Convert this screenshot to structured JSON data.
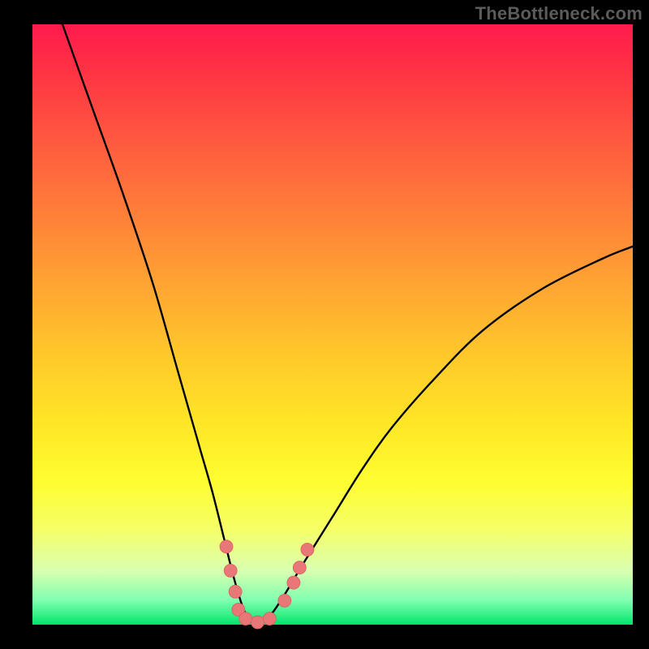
{
  "watermark": "TheBottleneck.com",
  "colors": {
    "page_bg": "#000000",
    "curve": "#000000",
    "dot_fill": "#e97777",
    "dot_stroke": "#d85f5f",
    "gradient_top": "#ff1a4d",
    "gradient_bottom": "#00e56a"
  },
  "chart_data": {
    "type": "line",
    "title": "",
    "xlabel": "",
    "ylabel": "",
    "xlim": [
      0,
      100
    ],
    "ylim": [
      0,
      100
    ],
    "grid": false,
    "legend": false,
    "series": [
      {
        "name": "bottleneck-curve",
        "x": [
          5,
          10,
          15,
          20,
          24,
          26,
          28,
          30,
          32,
          33.5,
          35,
          36,
          37,
          38,
          39,
          40,
          42,
          45,
          50,
          55,
          60,
          67,
          75,
          85,
          95,
          100
        ],
        "y": [
          100,
          86,
          72,
          57,
          43,
          36,
          29,
          22,
          14,
          8,
          3,
          1,
          0,
          0,
          1,
          2,
          5,
          10,
          18,
          26,
          33,
          41,
          49,
          56,
          61,
          63
        ]
      }
    ],
    "points": [
      {
        "name": "p1",
        "x": 32.3,
        "y": 13
      },
      {
        "name": "p2",
        "x": 33.0,
        "y": 9
      },
      {
        "name": "p3",
        "x": 33.8,
        "y": 5.5
      },
      {
        "name": "p4",
        "x": 34.3,
        "y": 2.5
      },
      {
        "name": "p5",
        "x": 35.5,
        "y": 1.0
      },
      {
        "name": "p6",
        "x": 37.5,
        "y": 0.4
      },
      {
        "name": "p7",
        "x": 39.5,
        "y": 1.0
      },
      {
        "name": "p8",
        "x": 42.0,
        "y": 4.0
      },
      {
        "name": "p9",
        "x": 43.5,
        "y": 7.0
      },
      {
        "name": "p10",
        "x": 44.5,
        "y": 9.5
      },
      {
        "name": "p11",
        "x": 45.8,
        "y": 12.5
      }
    ],
    "notes": "x and y are in percent of plot-area width/height; y=0 is the bottom (green), y=100 is the top (red). Values are estimated from the rendered image."
  }
}
